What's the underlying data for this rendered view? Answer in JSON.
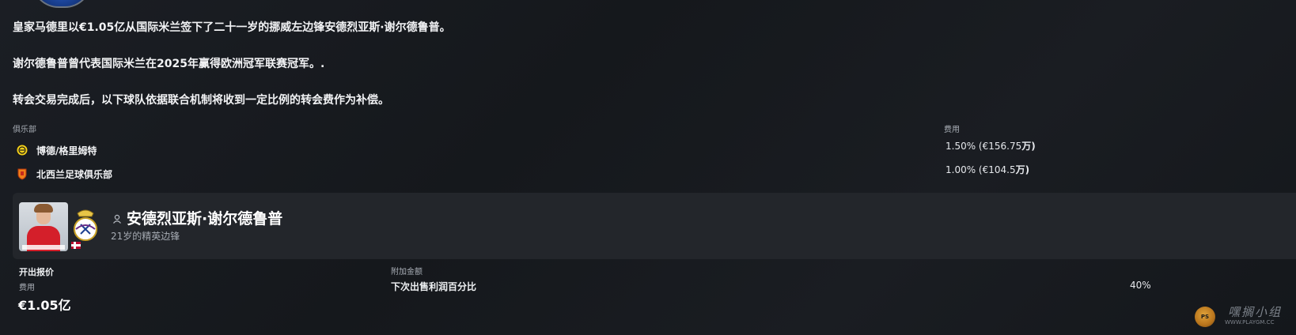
{
  "news": {
    "line1": "皇家马德里以€1.05亿从国际米兰签下了二十一岁的挪威左边锋安德烈亚斯·谢尔德鲁普。",
    "line2": "谢尔德鲁普曾代表国际米兰在2025年赢得欧洲冠军联赛冠军。.",
    "line3": "转会交易完成后，以下球队依据联合机制将收到一定比例的转会费作为补偿。"
  },
  "solidarity_table": {
    "col_club": "俱乐部",
    "col_fee": "费用",
    "rows": [
      {
        "club": "博德/格里姆特",
        "fee": "1.50% (€156.75",
        "fee_unit": "万)",
        "icon": "bodo-glimt-crest-icon"
      },
      {
        "club": "北西兰足球俱乐部",
        "fee": "1.00% (€104.5",
        "fee_unit": "万)",
        "icon": "nordsjaelland-crest-icon"
      }
    ]
  },
  "player": {
    "name": "安德烈亚斯·谢尔德鲁普",
    "description": "21岁的精英边锋",
    "nationality_flag": "norway-flag-icon",
    "club_crest": "real-madrid-crest-icon"
  },
  "offer": {
    "title": "开出报价",
    "fee_label": "费用",
    "fee_value": "€1.05亿",
    "addons_label": "附加金额",
    "addon_name": "下次出售利润百分比",
    "addon_value": "40%"
  },
  "watermark": {
    "cn": "嘿搁小组",
    "en": "WWW.PLAYGM.CC",
    "logo_text": "PS"
  },
  "colors": {
    "background": "#181b20",
    "card": "#23262b",
    "text_primary": "#f2f3f5",
    "text_secondary": "#a9aeb6"
  }
}
